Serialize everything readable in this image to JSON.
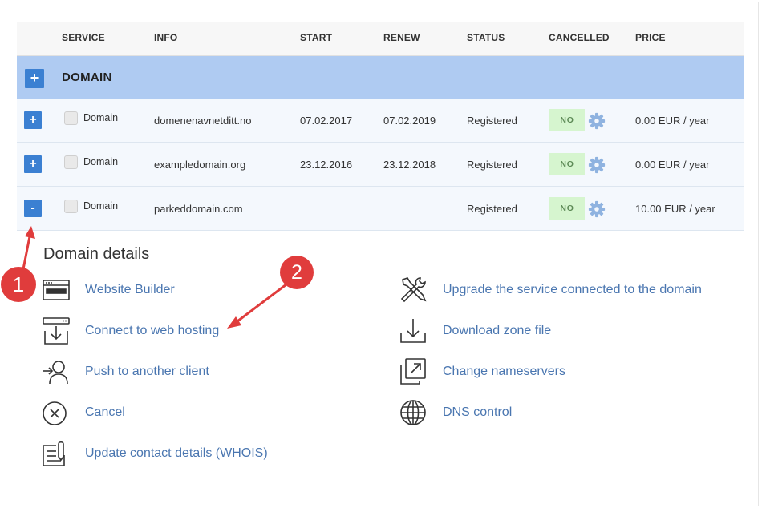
{
  "table": {
    "headers": [
      "SERVICE",
      "INFO",
      "START",
      "RENEW",
      "STATUS",
      "CANCELLED",
      "PRICE"
    ],
    "group": {
      "expand_symbol": "+",
      "title": "DOMAIN"
    },
    "rows": [
      {
        "toggle": "+",
        "service": "Domain",
        "info": "domenenavnetditt.no",
        "start": "07.02.2017",
        "renew": "07.02.2019",
        "status": "Registered",
        "cancelled": "NO",
        "price": "0.00 EUR / year"
      },
      {
        "toggle": "+",
        "service": "Domain",
        "info": "exampledomain.org",
        "start": "23.12.2016",
        "renew": "23.12.2018",
        "status": "Registered",
        "cancelled": "NO",
        "price": "0.00 EUR / year"
      },
      {
        "toggle": "-",
        "service": "Domain",
        "info": "parkeddomain.com",
        "start": "",
        "renew": "",
        "status": "Registered",
        "cancelled": "NO",
        "price": "10.00 EUR / year"
      }
    ]
  },
  "details": {
    "title": "Domain details",
    "left": [
      {
        "icon": "website-builder-icon",
        "label": "Website Builder"
      },
      {
        "icon": "web-hosting-icon",
        "label": "Connect to web hosting"
      },
      {
        "icon": "push-client-icon",
        "label": "Push to another client"
      },
      {
        "icon": "cancel-icon",
        "label": "Cancel"
      },
      {
        "icon": "contact-details-icon",
        "label": "Update contact details (WHOIS)"
      }
    ],
    "right": [
      {
        "icon": "tools-icon",
        "label": "Upgrade the service connected to the domain"
      },
      {
        "icon": "download-icon",
        "label": "Download zone file"
      },
      {
        "icon": "nameservers-icon",
        "label": "Change nameservers"
      },
      {
        "icon": "globe-icon",
        "label": "DNS control"
      }
    ]
  },
  "annotations": [
    {
      "number": "1"
    },
    {
      "number": "2"
    }
  ],
  "colors": {
    "accent": "#3b80d2",
    "group_bg": "#afcbf2",
    "link": "#4a76b0",
    "marker": "#e03c3c",
    "badge_bg": "#d6f5cf"
  }
}
